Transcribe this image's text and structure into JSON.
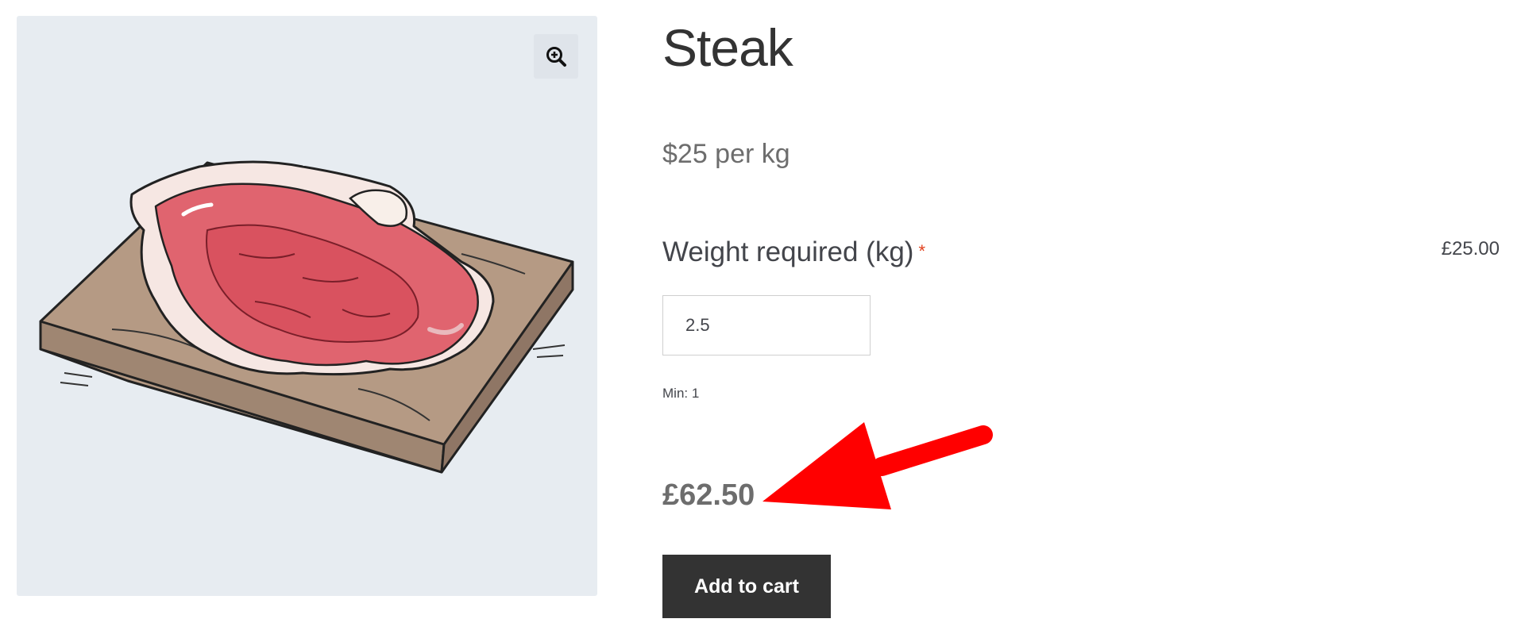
{
  "product": {
    "title": "Steak",
    "unit_price": "$25 per kg",
    "image_alt": "Illustration of a steak on a wooden cutting board"
  },
  "gallery": {
    "zoom_icon": "magnifier-plus-icon"
  },
  "weight_field": {
    "label": "Weight required (kg)",
    "required_marker": "*",
    "option_price": "£25.00",
    "value": "2.5",
    "min_note": "Min: 1"
  },
  "total": {
    "price": "£62.50"
  },
  "actions": {
    "add_to_cart_label": "Add to cart"
  },
  "colors": {
    "image_background": "#e7ecf1",
    "button_background": "#333333",
    "required_star": "#e2401c",
    "annotation_arrow": "#ff0000"
  }
}
